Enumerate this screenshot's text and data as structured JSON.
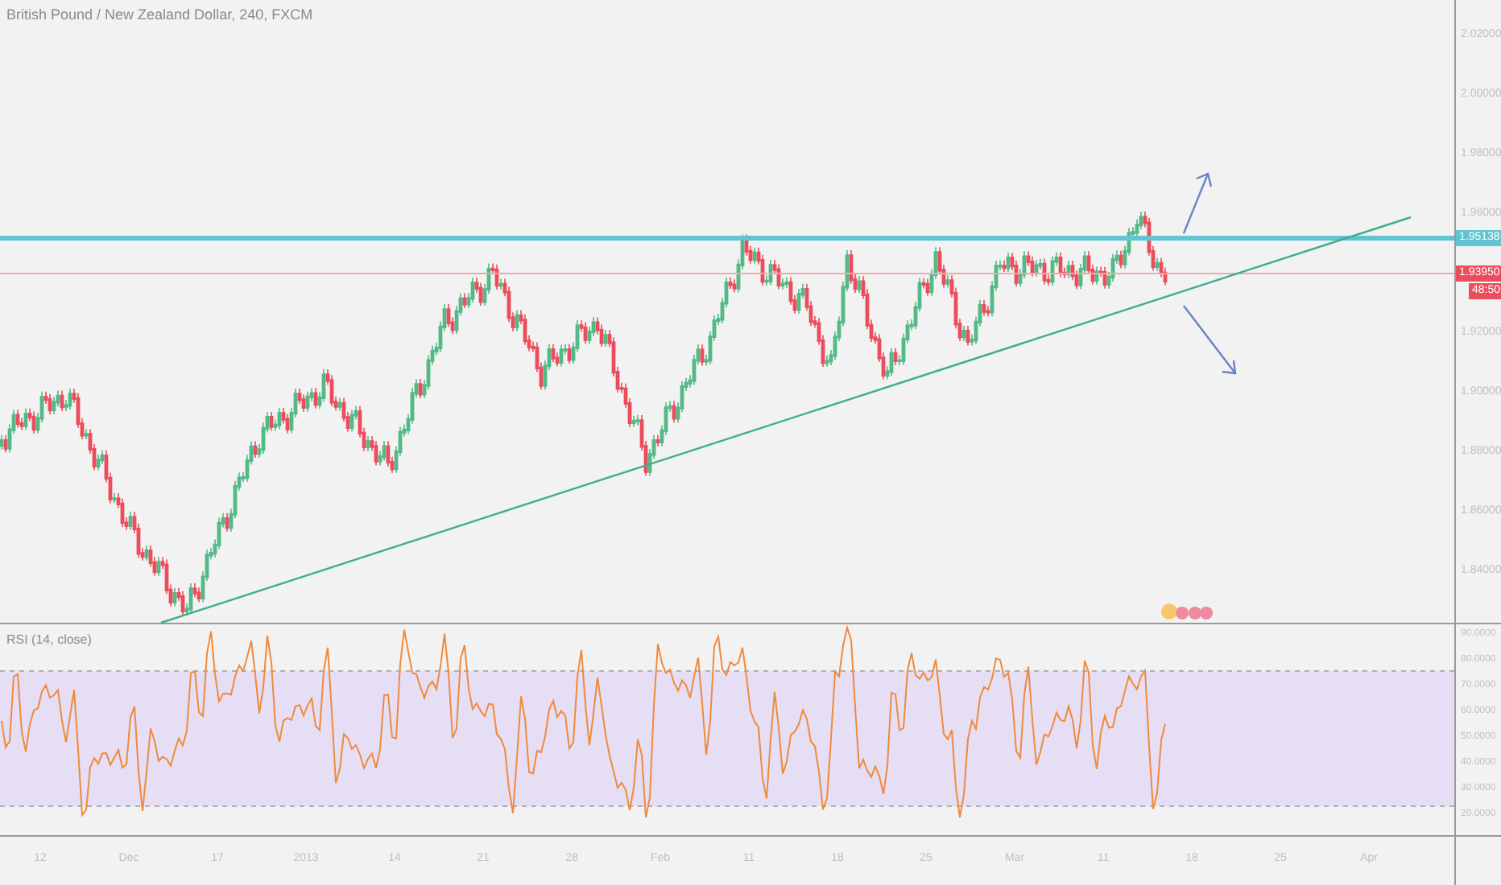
{
  "chart_title": "British Pound / New Zealand Dollar, 240, FXCM",
  "price_axis": [
    "2.02000",
    "2.00000",
    "1.98000",
    "1.96000",
    "1.92000",
    "1.90000",
    "1.88000",
    "1.86000",
    "1.84000"
  ],
  "price_tags": [
    {
      "value": "1.95138",
      "color": "#5fc5d1"
    },
    {
      "value": "1.93950",
      "color": "#eb4d5c"
    }
  ],
  "countdown": "48:50",
  "rsi": {
    "title": "RSI (14, close)",
    "axis": [
      "90.0000",
      "80.0000",
      "70.0000",
      "60.0000",
      "50.0000",
      "40.0000",
      "30.0000",
      "20.0000"
    ]
  },
  "time_axis": [
    "12",
    "Dec",
    "17",
    "2013",
    "14",
    "21",
    "28",
    "Feb",
    "11",
    "18",
    "25",
    "Mar",
    "11",
    "18",
    "25",
    "Apr"
  ]
}
